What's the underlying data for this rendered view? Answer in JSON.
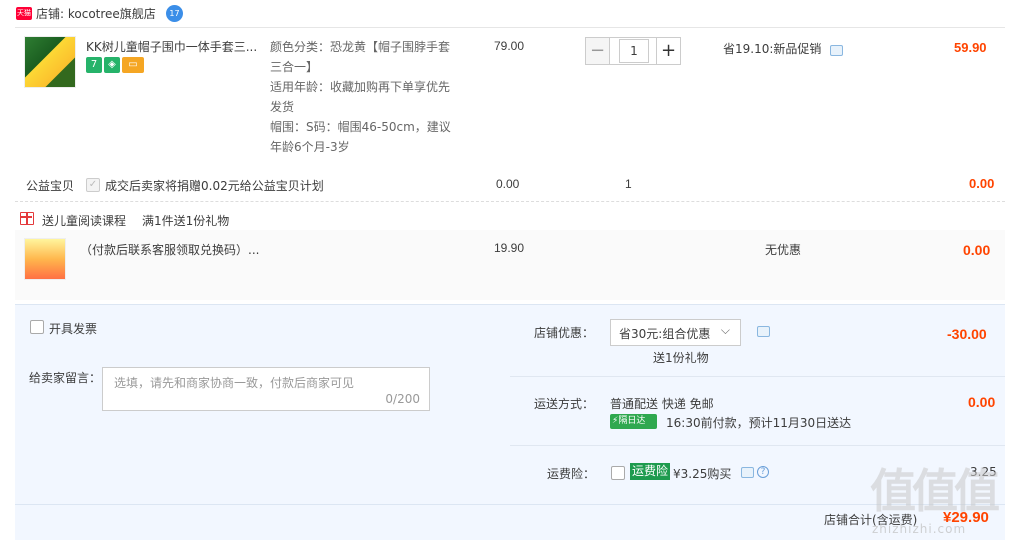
{
  "store": {
    "badge": "天猫",
    "name": "店铺: kocotree旗舰店",
    "chat_badge": "17"
  },
  "item": {
    "title": "KK树儿童帽子围巾一体手套三...",
    "sku": [
      "颜色分类：恐龙黄【帽子围脖手套三合一】",
      "适用年龄：收藏加购再下单享优先发货",
      "帽围：S码：帽围46-50cm，建议年龄6个月-3岁"
    ],
    "unit_price": "79.00",
    "qty": "1",
    "promo": "省19.10:新品促销",
    "total": "59.90",
    "svc_icons": [
      "seven-day-icon",
      "guarantee-icon",
      "card-icon"
    ]
  },
  "charity": {
    "label": "公益宝贝",
    "text": "成交后卖家将捐赠0.02元给公益宝贝计划",
    "price": "0.00",
    "qty": "1",
    "total": "0.00"
  },
  "gift": {
    "title": "送儿童阅读课程",
    "rule": "满1件送1份礼物",
    "item_title": "（付款后联系客服领取兑换码）...",
    "price": "19.90",
    "discount": "无优惠",
    "total": "0.00"
  },
  "invoice": {
    "label": "开具发票"
  },
  "message": {
    "label": "给卖家留言：",
    "placeholder": "选填，请先和商家协商一致，付款后商家可见",
    "counter": "0/200"
  },
  "store_discount": {
    "label": "店铺优惠：",
    "selected": "省30元:组合优惠",
    "gift_note": "送1份礼物",
    "amount": "-30.00"
  },
  "shipping": {
    "label": "运送方式：",
    "method": "普通配送 快递 免邮",
    "badge": "隔日达",
    "eta": "16:30前付款，预计11月30日送达",
    "amount": "0.00"
  },
  "insurance": {
    "label": "运费险：",
    "tag": "运费险",
    "price": "¥3.25购买",
    "amount": "3.25"
  },
  "summary": {
    "label": "店铺合计(含运费)",
    "amount": "¥29.90"
  },
  "watermark": {
    "text": "值值值",
    "sub": "zhizhizhi.com"
  }
}
